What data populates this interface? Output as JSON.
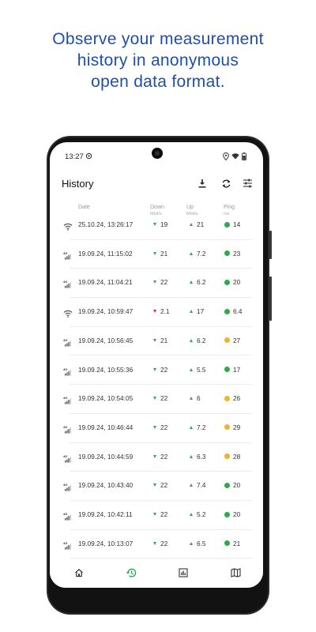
{
  "headline": [
    "Observe your measurement",
    "history in anonymous",
    "open data format."
  ],
  "status": {
    "time": "13:27"
  },
  "appbar": {
    "title": "History",
    "icons": [
      "download-icon",
      "sync-icon",
      "filter-icon"
    ]
  },
  "columns": {
    "date": "Date",
    "down": "Down",
    "down_unit": "Mbit/s",
    "up": "Up",
    "up_unit": "Mbit/s",
    "ping": "Ping",
    "ping_unit": "ms"
  },
  "colors": {
    "accent": "#1f4fa8",
    "good": "#2fa84f",
    "bad": "#e02b2b",
    "ping_good": "#2fa84f",
    "ping_medium": "#f0b429",
    "nav_active": "#2fa84f"
  },
  "rows": [
    {
      "net": "wifi",
      "date": "25.10.24, 13:26:17",
      "down": "19",
      "down_q": "good",
      "up": "21",
      "ping": "14",
      "ping_q": "good"
    },
    {
      "net": "4g",
      "date": "19.09.24, 11:15:02",
      "down": "21",
      "down_q": "good",
      "up": "7.2",
      "ping": "23",
      "ping_q": "good"
    },
    {
      "net": "4g",
      "date": "19.09.24, 11:04:21",
      "down": "22",
      "down_q": "good",
      "up": "6.2",
      "ping": "20",
      "ping_q": "good"
    },
    {
      "net": "wifi",
      "date": "19.09.24, 10:59:47",
      "down": "2.1",
      "down_q": "bad",
      "up": "17",
      "ping": "6.4",
      "ping_q": "good"
    },
    {
      "net": "4g",
      "date": "19.09.24, 10:56:45",
      "down": "21",
      "down_q": "good",
      "up": "6.2",
      "ping": "27",
      "ping_q": "medium"
    },
    {
      "net": "4g",
      "date": "19.09.24, 10:55:36",
      "down": "22",
      "down_q": "good",
      "up": "5.5",
      "ping": "17",
      "ping_q": "good"
    },
    {
      "net": "4g",
      "date": "19.09.24, 10:54:05",
      "down": "22",
      "down_q": "good",
      "up": "6",
      "ping": "26",
      "ping_q": "medium"
    },
    {
      "net": "4g",
      "date": "19.09.24, 10:46:44",
      "down": "22",
      "down_q": "good",
      "up": "7.2",
      "ping": "29",
      "ping_q": "medium"
    },
    {
      "net": "4g",
      "date": "19.09.24, 10:44:59",
      "down": "22",
      "down_q": "good",
      "up": "6.3",
      "ping": "28",
      "ping_q": "medium"
    },
    {
      "net": "4g",
      "date": "19.09.24, 10:43:40",
      "down": "22",
      "down_q": "good",
      "up": "7.4",
      "ping": "20",
      "ping_q": "good"
    },
    {
      "net": "4g",
      "date": "19.09.24, 10:42:11",
      "down": "22",
      "down_q": "good",
      "up": "5.2",
      "ping": "20",
      "ping_q": "good"
    },
    {
      "net": "4g",
      "date": "19.09.24, 10:13:07",
      "down": "22",
      "down_q": "good",
      "up": "6.5",
      "ping": "21",
      "ping_q": "good"
    }
  ],
  "bottomnav": {
    "items": [
      "home-icon",
      "history-icon",
      "statistics-icon",
      "map-icon"
    ],
    "active": "history-icon"
  }
}
